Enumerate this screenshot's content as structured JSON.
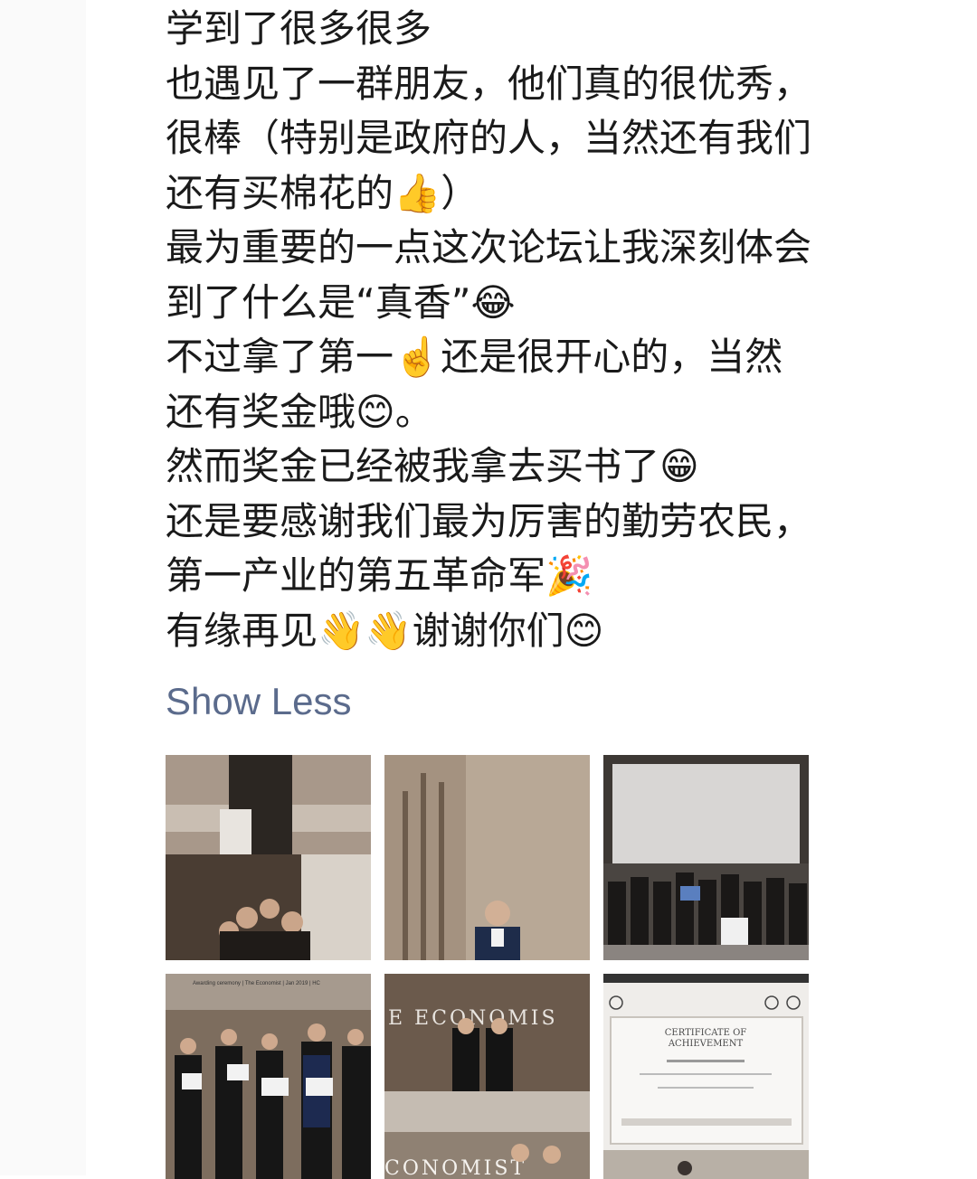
{
  "post": {
    "lines": [
      "学到了很多很多",
      "也遇见了一群朋友，他们真的很优秀，",
      "很棒（特别是政府的人，当然还有我们",
      "还有买棉花的👍）",
      "最为重要的一点这次论坛让我深刻体会",
      "到了什么是“真香”😂",
      "不过拿了第一☝️还是很开心的，当然",
      "还有奖金哦😊。",
      "然而奖金已经被我拿去买书了😁",
      "还是要感谢我们最为厉害的勤劳农民，",
      "第一产业的第五革命军🎉",
      "有缘再见👋👋谢谢你们😊"
    ],
    "show_less_label": "Show Less"
  },
  "photos": [
    {
      "name": "award-ceremony-photo-collage",
      "texts": []
    },
    {
      "name": "speaker-at-podium-photo",
      "texts": []
    },
    {
      "name": "group-photo-stage",
      "texts": []
    },
    {
      "name": "certificate-holders-photo",
      "texts": [
        "Awarding ceremony  |  The Economist  |  Jan 2019  |  HC"
      ]
    },
    {
      "name": "economist-backdrop-photo",
      "texts": [
        "E ECONOMIS",
        "CONOMIST"
      ]
    },
    {
      "name": "certificate-of-achievement-photo",
      "texts": [
        "CERTIFICATE OF",
        "ACHIEVEMENT"
      ]
    }
  ]
}
